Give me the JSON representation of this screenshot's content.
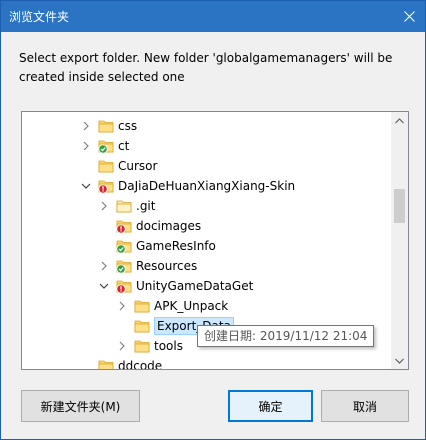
{
  "window": {
    "title": "浏览文件夹",
    "message": "Select export folder. New folder 'globalgamemanagers' will be created inside selected one"
  },
  "tree": {
    "rows": [
      {
        "label": "css",
        "chevron": "right",
        "overlay": "none"
      },
      {
        "label": "ct",
        "chevron": "right",
        "overlay": "green-check"
      },
      {
        "label": "Cursor",
        "chevron": "none",
        "overlay": "none"
      },
      {
        "label": "DaJiaDeHuanXiangXiang-Skin",
        "chevron": "down",
        "overlay": "red-alert"
      },
      {
        "label": ".git",
        "chevron": "right",
        "overlay": "none",
        "faded": true
      },
      {
        "label": "docimages",
        "chevron": "none",
        "overlay": "red-alert"
      },
      {
        "label": "GameResInfo",
        "chevron": "none",
        "overlay": "green-check"
      },
      {
        "label": "Resources",
        "chevron": "right",
        "overlay": "green-check"
      },
      {
        "label": "UnityGameDataGet",
        "chevron": "down",
        "overlay": "red-alert"
      },
      {
        "label": "APK_Unpack",
        "chevron": "right",
        "overlay": "none"
      },
      {
        "label": "Export_Data",
        "chevron": "none",
        "overlay": "none",
        "selected": true
      },
      {
        "label": "tools",
        "chevron": "right",
        "overlay": "none"
      },
      {
        "label": "ddcode",
        "chevron": "none",
        "overlay": "none"
      }
    ]
  },
  "tooltip": {
    "text": "创建日期: 2019/11/12 21:04"
  },
  "buttons": {
    "new_folder": "新建文件夹(M)",
    "ok": "确定",
    "cancel": "取消"
  },
  "colors": {
    "titlebar": "#2b74c4",
    "folder": "#ffd35e",
    "green_check": "#2e9e3e",
    "red_alert": "#d9232d",
    "selection": "#cce8ff"
  }
}
